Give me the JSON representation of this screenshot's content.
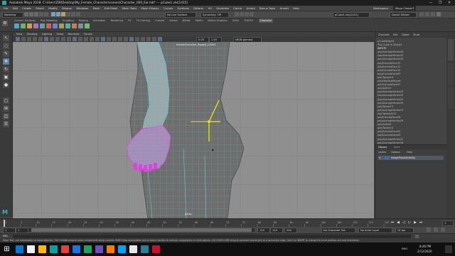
{
  "app": {
    "window_title": "Autodesk Maya 2018: C:\\Users\\ZW\\Desktop\\My_Female_Character\\scenes\\Character_000_Ear.mb* --- pCube1.vtx[1415]",
    "window_controls": {
      "minimize": "—",
      "maximize": "❐",
      "close": "✕"
    }
  },
  "menu": [
    "File",
    "Edit",
    "Create",
    "Select",
    "Modify",
    "Display",
    "Windows",
    "Mesh",
    "Edit Mesh",
    "Mesh Tools",
    "Mesh Display",
    "Curves",
    "Surfaces",
    "Deform",
    "UV",
    "Generate",
    "Cache",
    "Arnold",
    "Bonus Tools",
    "Arnold",
    "Help"
  ],
  "menu_right": {
    "workspace_label": "Workspace:",
    "workspace_value": "Maya Classic*"
  },
  "status_line": {
    "mode": "Modeling",
    "live_surface": "No Live Surface",
    "symmetry": "Symmetry: Off",
    "selection_field": "pCube1.vtx[1415]",
    "user": "Daniel Gilbert"
  },
  "shelf": {
    "tabs": [
      "Curves / Surfaces",
      "Poly Modeling",
      "Sculpting",
      "Rigging",
      "Animation",
      "Rendering",
      "FX",
      "FX Caching",
      "Custom",
      "Arnold",
      "Bifrost",
      "MASH",
      "Motion Graphics",
      "XGen",
      "TURTLE",
      "Character"
    ],
    "active_tab": "Character",
    "icon_colors": [
      "#5aa0d0",
      "#6ab36a",
      "#d0a050",
      "#b070c0",
      "#60a0a0",
      "#d06060",
      "#7080d0",
      "#a0a060",
      "#50b0b0",
      "#c08050",
      "#8090a0",
      "#70c070"
    ]
  },
  "panel_menu": [
    "View",
    "Shading",
    "Lighting",
    "Show",
    "Renderer",
    "Panels"
  ],
  "panel_toolbar": {
    "field_a": "0.00",
    "field_b": "1.00",
    "color_mgmt": "sRGB gamma"
  },
  "viewport": {
    "hud_top": "femaleCharacter_Rigged_v.0003",
    "hud_bottom": "persp",
    "selection_color": "#e040e0",
    "wire_color": "#5fd0d0",
    "manip_color": "#e6e600"
  },
  "toolbox": {
    "tools": [
      "select-tool",
      "lasso-tool",
      "paint-select-tool",
      "move-tool",
      "rotate-tool",
      "scale-tool",
      "last-tool"
    ],
    "layouts": [
      "single-pane-layout",
      "four-pane-layout",
      "side-by-side-layout",
      "outliner-layout"
    ]
  },
  "channel_box": {
    "tabs": [
      "Channels",
      "Edit",
      "Object",
      "Show"
    ],
    "history": [
      "pCubeShape1",
      "Poly Cube In Shape1",
      "INPUTS",
      "polyAverageVertex36",
      "polyAverageVertex35",
      "polyAverageVertex34",
      "polyExtrudeFace12",
      "polyExtrudeFace11",
      "polyExtrudeFace10",
      "polyExtrudeFace09",
      "polyTweak16",
      "polyMapSewMove6",
      "polyExtrudeFace07",
      "polySplit10",
      "polyAverageVertex33",
      "polyAverageVertex32",
      "polyAverageVertex31",
      "polyAverageVertex30",
      "polyTweak15",
      "polyAverageVertex29",
      "polyTweakUV11",
      "polyExtrudeFace06",
      "polyAverageVertex28",
      "polySplit09",
      "polyTweak14",
      "polyExtrudeFace05",
      "polyExtrudeFace04",
      "polyAverageVertex27",
      "polyAverageVertex26"
    ]
  },
  "layer_editor": {
    "tabs": [
      "Display",
      "Anim"
    ],
    "menu": [
      "Layers",
      "Options",
      "Help"
    ],
    "layers": [
      {
        "name": "ImagePlaneVisibility",
        "visible": "V",
        "color": "#3a6fb0"
      }
    ]
  },
  "timeline": {
    "ticks": [
      "1",
      "5",
      "10",
      "15",
      "20",
      "25",
      "30",
      "35",
      "40",
      "45",
      "50",
      "55",
      "60",
      "65",
      "70",
      "75",
      "80",
      "85",
      "90",
      "95",
      "100",
      "105",
      "110",
      "115",
      "120"
    ],
    "current_frame": "1"
  },
  "range_slider": {
    "start": "1",
    "inner_start": "1",
    "inner_end": "120",
    "end": "120",
    "anim_end": "200",
    "character_set": "No Character Set",
    "anim_layer": "No Anim Layer",
    "fps": "24 fps"
  },
  "command_line": {
    "label": "MEL",
    "value": ""
  },
  "help_line": "Move Tool: use manipulator to move object(s). Ctrl+middle-drag to move components along normals. Shift+drag manipulator axis or plane handles to extrude components or clone objects. Ctrl+Shift+LMB+drag to constrain movement to a connected edge. Use D or INSERT to change the pivot position and axis orientation.",
  "taskbar": {
    "icon_colors": [
      "#0078d4",
      "#f0f0f0",
      "#ffb900",
      "#0aa0a0",
      "#e04040",
      "#1a73e8",
      "#20a060",
      "#6b4fbb",
      "#ff7a00",
      "#00a4ef",
      "#e8e8e8",
      "#2d7d9a",
      "#c8102e"
    ],
    "time": "8:46 PM",
    "date": "2/12/2020",
    "tray_text": "ENG"
  }
}
